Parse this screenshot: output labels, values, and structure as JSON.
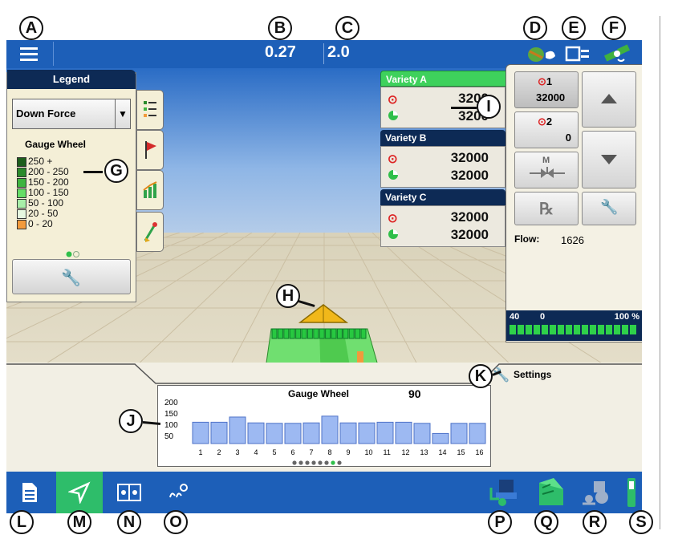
{
  "topbar": {
    "value_b": "0.27",
    "value_c": "2.0"
  },
  "legend": {
    "title": "Legend",
    "selected_layer": "Down Force",
    "section_title": "Gauge Wheel",
    "ranges": [
      {
        "label": "250 +",
        "color": "#1d5e1d"
      },
      {
        "label": "200 - 250",
        "color": "#2b8a2b"
      },
      {
        "label": "150 - 200",
        "color": "#3fb43f"
      },
      {
        "label": "100 - 150",
        "color": "#66dd66"
      },
      {
        "label": "50 - 100",
        "color": "#a8eea8"
      },
      {
        "label": "20 - 50",
        "color": "#e6f7e0"
      },
      {
        "label": "0 - 20",
        "color": "#f29a3c"
      }
    ]
  },
  "varieties": [
    {
      "name": "Variety A",
      "target": "3200",
      "applied": "3200",
      "active": true
    },
    {
      "name": "Variety B",
      "target": "32000",
      "applied": "32000",
      "active": false
    },
    {
      "name": "Variety C",
      "target": "32000",
      "applied": "32000",
      "active": false
    }
  ],
  "rate_panel": {
    "rate1_label": "1",
    "rate1_value": "32000",
    "rate2_label": "2",
    "rate2_value": "0",
    "manual_label": "M",
    "rx_label": "℞",
    "flow_label": "Flow:",
    "flow_value": "1626",
    "bar_left": "40",
    "bar_mid": "0",
    "bar_right": "100 %"
  },
  "settings_label": "Settings",
  "chart_data": {
    "type": "bar",
    "title": "Gauge Wheel",
    "current_value": "90",
    "categories": [
      "1",
      "2",
      "3",
      "4",
      "5",
      "6",
      "7",
      "8",
      "9",
      "10",
      "11",
      "12",
      "13",
      "14",
      "15",
      "16"
    ],
    "values": [
      95,
      95,
      118,
      92,
      90,
      90,
      92,
      122,
      92,
      92,
      95,
      95,
      90,
      45,
      90,
      90
    ],
    "ylim": [
      0,
      200
    ],
    "yticks": [
      "200",
      "150",
      "100",
      "50"
    ],
    "grid": false
  },
  "callouts": [
    "A",
    "B",
    "C",
    "D",
    "E",
    "F",
    "G",
    "H",
    "I",
    "J",
    "K",
    "L",
    "M",
    "N",
    "O",
    "P",
    "Q",
    "R",
    "S"
  ],
  "icons": {
    "menu": "menu-icon",
    "gps": "gps-icon",
    "display": "display-icon",
    "satellite": "satellite-icon",
    "summary": "summary-icon",
    "map": "map-icon",
    "split": "split-view-icon",
    "row": "row-icon",
    "planter": "planter-icon",
    "field": "field-icon",
    "tractor": "tractor-icon",
    "light": "light-icon"
  },
  "colors": {
    "bar_blue": "#1d5fb8",
    "legend_header": "#0d2a55",
    "variety_active": "#3ed15c",
    "variety_header": "#0d2a55",
    "active_tab": "#2ebd6a"
  }
}
